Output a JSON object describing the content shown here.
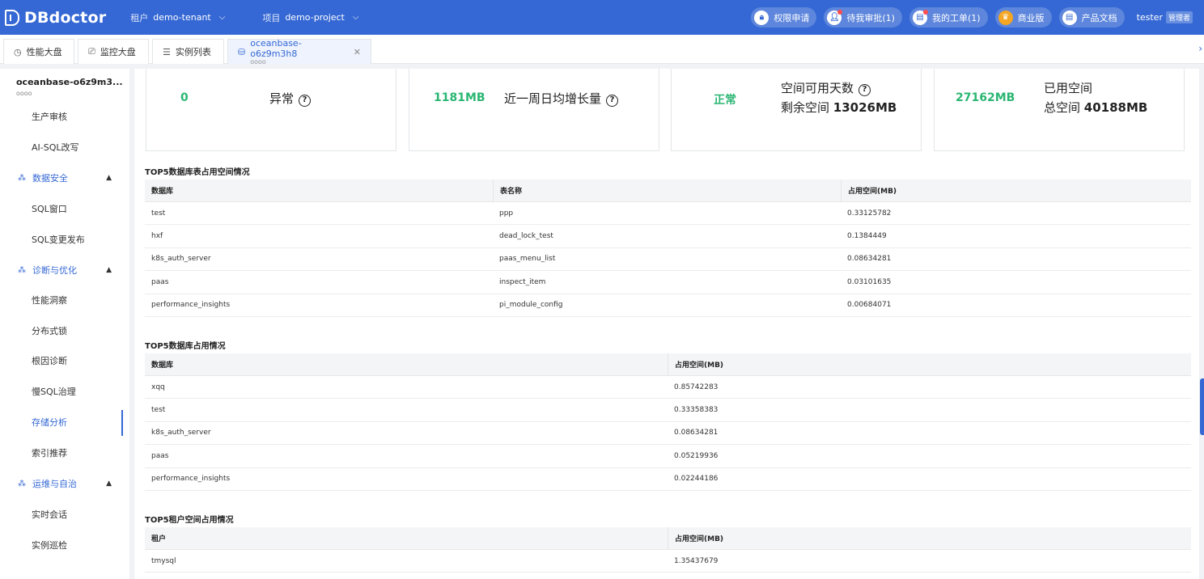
{
  "app": {
    "name": "DBdoctor"
  },
  "header": {
    "tenant_key": "租户",
    "tenant_value": "demo-tenant",
    "project_key": "项目",
    "project_value": "demo-project",
    "buttons": [
      {
        "label": "权限申请",
        "icon": "lock-icon"
      },
      {
        "label": "待我审批(1)",
        "icon": "user-approve-icon"
      },
      {
        "label": "我的工单(1)",
        "icon": "ticket-icon"
      },
      {
        "label": "商业版",
        "icon": "crown-icon"
      },
      {
        "label": "产品文档",
        "icon": "document-icon"
      }
    ],
    "user": "tester",
    "role": "管理者"
  },
  "tabs": [
    {
      "label": "性能大盘",
      "icon": "dashboard-icon"
    },
    {
      "label": "监控大盘",
      "icon": "monitor-icon"
    },
    {
      "label": "实例列表",
      "icon": "list-icon"
    },
    {
      "label": "oceanbase-o6z9m3h8",
      "sub": "oooo",
      "icon": "database-icon",
      "active": true
    }
  ],
  "sidebar": {
    "title": "oceanbase-o6z9m3...",
    "subtitle": "oooo",
    "items": [
      {
        "label": "生产审核"
      },
      {
        "label": "AI-SQL改写"
      },
      {
        "label": "数据安全",
        "group": true
      },
      {
        "label": "SQL窗口"
      },
      {
        "label": "SQL变更发布"
      },
      {
        "label": "诊断与优化",
        "group": true
      },
      {
        "label": "性能洞察"
      },
      {
        "label": "分布式锁"
      },
      {
        "label": "根因诊断"
      },
      {
        "label": "慢SQL治理"
      },
      {
        "label": "存储分析",
        "active": true
      },
      {
        "label": "索引推荐"
      },
      {
        "label": "运维与自治",
        "group": true
      },
      {
        "label": "实时会话"
      },
      {
        "label": "实例巡检"
      }
    ]
  },
  "cards": [
    {
      "value": "0",
      "label": "异常"
    },
    {
      "value": "1181MB",
      "label": "近一周日均增长量"
    },
    {
      "value": "正常",
      "line1": "空间可用天数",
      "line2_key": "剩余空间",
      "line2_val": "13026MB"
    },
    {
      "value": "27162MB",
      "line1": "已用空间",
      "line2_key": "总空间",
      "line2_val": "40188MB"
    }
  ],
  "table1": {
    "title": "TOP5数据库表占用空间情况",
    "headers": [
      "数据库",
      "表名称",
      "占用空间(MB)"
    ],
    "rows": [
      [
        "test",
        "ppp",
        "0.33125782"
      ],
      [
        "hxf",
        "dead_lock_test",
        "0.1384449"
      ],
      [
        "k8s_auth_server",
        "paas_menu_list",
        "0.08634281"
      ],
      [
        "paas",
        "inspect_item",
        "0.03101635"
      ],
      [
        "performance_insights",
        "pi_module_config",
        "0.00684071"
      ]
    ]
  },
  "table2": {
    "title": "TOP5数据库占用情况",
    "headers": [
      "数据库",
      "占用空间(MB)"
    ],
    "rows": [
      [
        "xqq",
        "0.85742283"
      ],
      [
        "test",
        "0.33358383"
      ],
      [
        "k8s_auth_server",
        "0.08634281"
      ],
      [
        "paas",
        "0.05219936"
      ],
      [
        "performance_insights",
        "0.02244186"
      ]
    ]
  },
  "table3": {
    "title": "TOP5租户空间占用情况",
    "headers": [
      "租户",
      "占用空间(MB)"
    ],
    "rows": [
      [
        "tmysql",
        "1.35437679"
      ]
    ]
  }
}
